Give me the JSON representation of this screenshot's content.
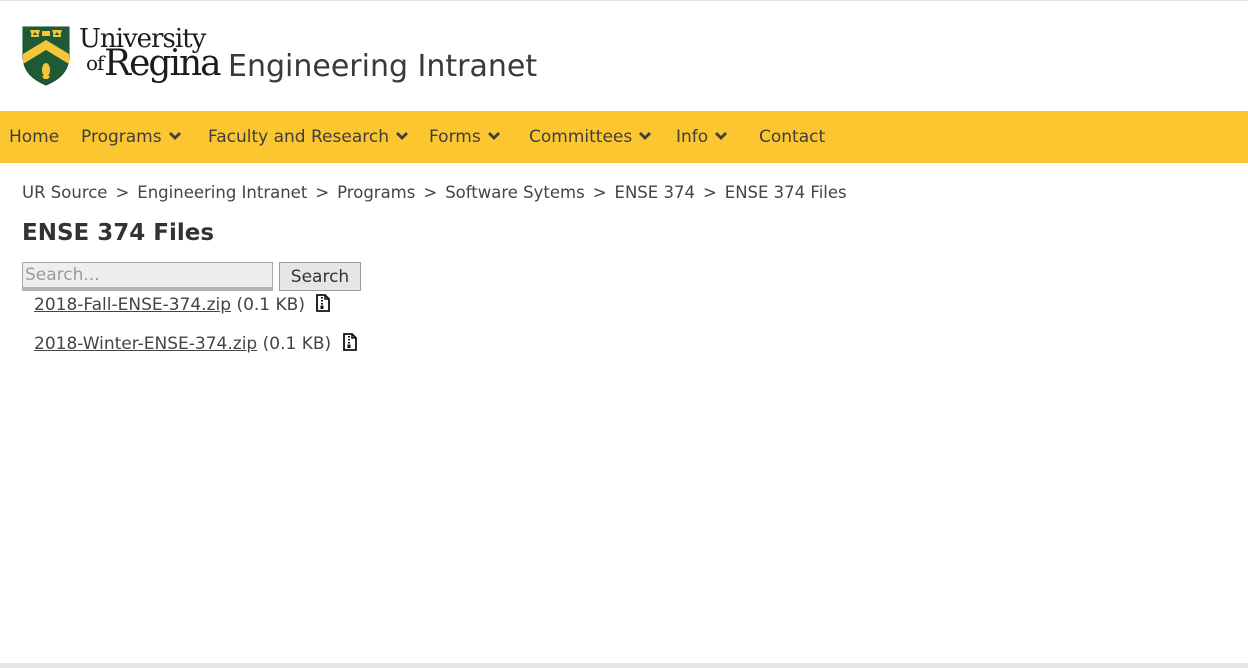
{
  "header": {
    "logo_line1": "University",
    "logo_of": "of",
    "logo_line2": "Regina",
    "site_title": "Engineering Intranet"
  },
  "nav": {
    "items": [
      {
        "label": "Home",
        "has_dropdown": false
      },
      {
        "label": "Programs",
        "has_dropdown": true
      },
      {
        "label": "Faculty and Research",
        "has_dropdown": true
      },
      {
        "label": "Forms",
        "has_dropdown": true
      },
      {
        "label": "Committees",
        "has_dropdown": true
      },
      {
        "label": "Info",
        "has_dropdown": true
      },
      {
        "label": "Contact",
        "has_dropdown": false
      }
    ],
    "background_color": "#fcc630"
  },
  "breadcrumb": {
    "items": [
      "UR Source",
      "Engineering Intranet",
      "Programs",
      "Software Sytems",
      "ENSE 374",
      "ENSE 374 Files"
    ],
    "separator": ">"
  },
  "main": {
    "title": "ENSE 374 Files",
    "search": {
      "placeholder": "Search...",
      "value": "",
      "button_label": "Search"
    },
    "files": [
      {
        "name": "2018-Fall-ENSE-374.zip",
        "size": "(0.1 KB)",
        "icon": "zip-file-icon"
      },
      {
        "name": "2018-Winter-ENSE-374.zip",
        "size": "(0.1 KB)",
        "icon": "zip-file-icon"
      }
    ]
  },
  "colors": {
    "brand_green": "#1e5b35",
    "brand_gold": "#fcc630"
  }
}
